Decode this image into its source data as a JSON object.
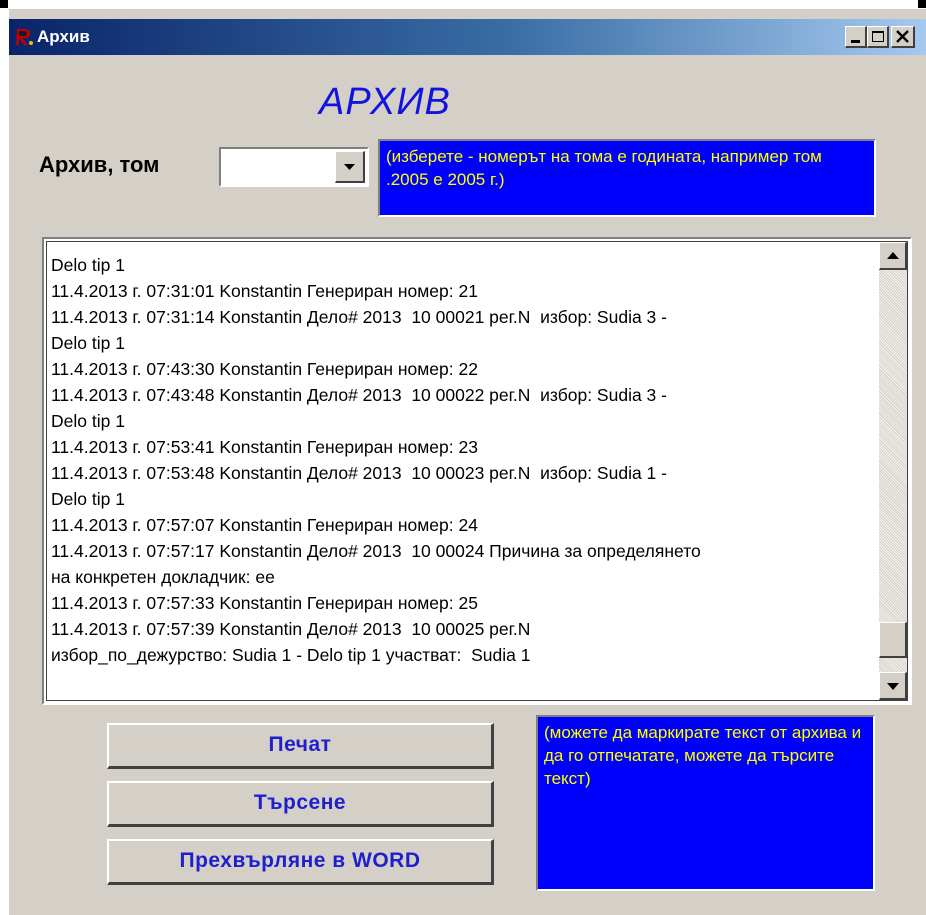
{
  "window": {
    "title": "Архив"
  },
  "heading": "АРХИВ",
  "volume": {
    "label": "Архив, том",
    "selected": "",
    "hint": "(изберете - номерът на тома е годината, например том .2005 е 2005 г.)"
  },
  "log": {
    "lines": [
      "Delo tip 1",
      "11.4.2013 г. 07:31:01 Konstantin Генериран номер: 21",
      "11.4.2013 г. 07:31:14 Konstantin Дело# 2013  10 00021 рег.N  избор: Sudia 3 -",
      "Delo tip 1",
      "11.4.2013 г. 07:43:30 Konstantin Генериран номер: 22",
      "11.4.2013 г. 07:43:48 Konstantin Дело# 2013  10 00022 рег.N  избор: Sudia 3 -",
      "Delo tip 1",
      "11.4.2013 г. 07:53:41 Konstantin Генериран номер: 23",
      "11.4.2013 г. 07:53:48 Konstantin Дело# 2013  10 00023 рег.N  избор: Sudia 1 -",
      "Delo tip 1",
      "11.4.2013 г. 07:57:07 Konstantin Генериран номер: 24",
      "11.4.2013 г. 07:57:17 Konstantin Дело# 2013  10 00024 Причина за определянето",
      "на конкретен докладчик: ее",
      "11.4.2013 г. 07:57:33 Konstantin Генериран номер: 25",
      "11.4.2013 г. 07:57:39 Konstantin Дело# 2013  10 00025 рег.N",
      "избор_по_дежурство: Sudia 1 - Delo tip 1 участват:  Sudia 1"
    ]
  },
  "buttons": {
    "print": "Печат",
    "search": "Търсене",
    "word": "Прехвърляне в WORD"
  },
  "info_hint": "(можете да маркирате текст от архива и да го отпечатате, можете да търсите текст)",
  "icons": {
    "app": "app-logo-icon",
    "minimize": "minimize-icon",
    "maximize": "maximize-icon",
    "close": "close-icon",
    "dropdown": "dropdown-arrow-icon",
    "scroll_up": "scroll-up-arrow-icon",
    "scroll_down": "scroll-down-arrow-icon"
  },
  "colors": {
    "hint_background": "#0000ff",
    "hint_text": "#ffff00",
    "heading": "#1313e0",
    "button_text": "#1f1fd0"
  }
}
